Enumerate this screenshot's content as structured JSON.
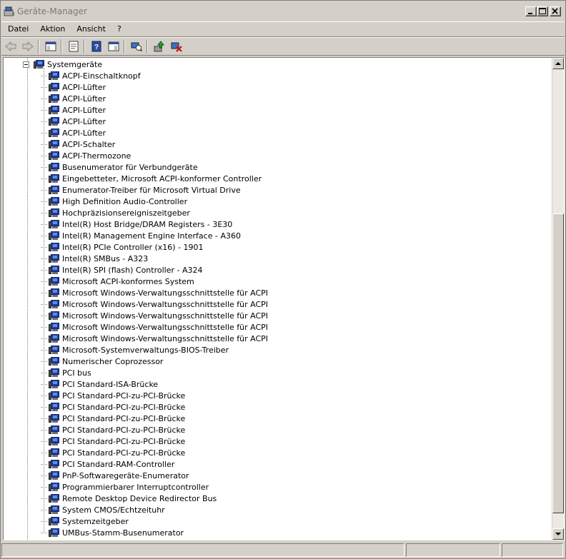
{
  "window": {
    "title": "Geräte-Manager"
  },
  "menu": [
    "Datei",
    "Aktion",
    "Ansicht",
    "?"
  ],
  "toolbar": {
    "icons": [
      "back-icon",
      "forward-icon",
      "console-tree-icon",
      "properties-icon",
      "help-icon",
      "view-icon",
      "scan-hardware-icon",
      "update-driver-icon",
      "uninstall-icon"
    ]
  },
  "tree": {
    "category": "Systemgeräte",
    "devices": [
      "ACPI-Einschaltknopf",
      "ACPI-Lüfter",
      "ACPI-Lüfter",
      "ACPI-Lüfter",
      "ACPI-Lüfter",
      "ACPI-Lüfter",
      "ACPI-Schalter",
      "ACPI-Thermozone",
      "Busenumerator für Verbundgeräte",
      "Eingebetteter, Microsoft ACPI-konformer Controller",
      "Enumerator-Treiber für Microsoft Virtual Drive",
      "High Definition Audio-Controller",
      "Hochpräzisionsereigniszeitgeber",
      "Intel(R) Host Bridge/DRAM Registers - 3E30",
      "Intel(R) Management Engine Interface - A360",
      "Intel(R) PCIe Controller (x16) - 1901",
      "Intel(R) SMBus - A323",
      "Intel(R) SPI (flash) Controller - A324",
      "Microsoft ACPI-konformes System",
      "Microsoft Windows-Verwaltungsschnittstelle für ACPI",
      "Microsoft Windows-Verwaltungsschnittstelle für ACPI",
      "Microsoft Windows-Verwaltungsschnittstelle für ACPI",
      "Microsoft Windows-Verwaltungsschnittstelle für ACPI",
      "Microsoft Windows-Verwaltungsschnittstelle für ACPI",
      "Microsoft-Systemverwaltungs-BIOS-Treiber",
      "Numerischer Coprozessor",
      "PCI bus",
      "PCI Standard-ISA-Brücke",
      "PCI Standard-PCI-zu-PCI-Brücke",
      "PCI Standard-PCI-zu-PCI-Brücke",
      "PCI Standard-PCI-zu-PCI-Brücke",
      "PCI Standard-PCI-zu-PCI-Brücke",
      "PCI Standard-PCI-zu-PCI-Brücke",
      "PCI Standard-PCI-zu-PCI-Brücke",
      "PCI Standard-RAM-Controller",
      "PnP-Softwaregeräte-Enumerator",
      "Programmierbarer Interruptcontroller",
      "Remote Desktop Device Redirector Bus",
      "System CMOS/Echtzeituhr",
      "Systemzeitgeber",
      "UMBus-Stamm-Busenumerator"
    ]
  },
  "colors": {
    "chrome": "#d4d0c8",
    "background": "#ffffff"
  }
}
